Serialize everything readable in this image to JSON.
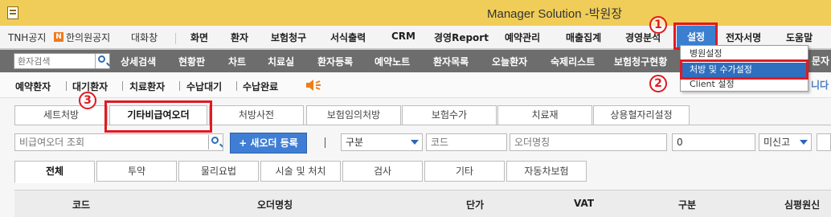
{
  "window": {
    "title": "Manager Solution -박원장"
  },
  "main_menu": {
    "items": [
      {
        "label": "TNH공지"
      },
      {
        "label": "N"
      },
      {
        "label": "한의원공지"
      },
      {
        "label": "대화창"
      },
      {
        "label": "화면"
      },
      {
        "label": "환자"
      },
      {
        "label": "보험청구"
      },
      {
        "label": "서식출력"
      },
      {
        "label": "CRM"
      },
      {
        "label": "경영Report"
      },
      {
        "label": "예약관리"
      },
      {
        "label": "매출집계"
      },
      {
        "label": "경영분석"
      },
      {
        "label": "설정"
      },
      {
        "label": "전자서명"
      },
      {
        "label": "도움말"
      }
    ]
  },
  "annotations": {
    "step1": "1",
    "step2": "2",
    "step3": "3"
  },
  "settings_dropdown": {
    "items": [
      {
        "label": "병원설정"
      },
      {
        "label": "처방 및 수가설정"
      },
      {
        "label": "Client 설정"
      }
    ]
  },
  "sub_menu": {
    "search_placeholder": "환자검색",
    "items": [
      {
        "label": "상세검색"
      },
      {
        "label": "현황판"
      },
      {
        "label": "차트"
      },
      {
        "label": "치료실"
      },
      {
        "label": "환자등록"
      },
      {
        "label": "예약노트"
      },
      {
        "label": "환자목록"
      },
      {
        "label": "오늘환자"
      },
      {
        "label": "숙제리스트"
      },
      {
        "label": "보험청구현황"
      }
    ],
    "right_cut": "문자",
    "right_cut2": "니다"
  },
  "reception_bar": {
    "items": [
      {
        "label": "예약환자"
      },
      {
        "label": "대기환자"
      },
      {
        "label": "치료환자"
      },
      {
        "label": "수납대기"
      },
      {
        "label": "수납완료"
      }
    ]
  },
  "top_tabs": [
    {
      "label": "세트처방"
    },
    {
      "label": "기타비급여오더"
    },
    {
      "label": "처방사전"
    },
    {
      "label": "보험임의처방"
    },
    {
      "label": "보험수가"
    },
    {
      "label": "치료재"
    },
    {
      "label": "상용혈자리설정"
    }
  ],
  "filters": {
    "order_search_placeholder": "비급여오더 조회",
    "new_order_label": "+ 새오더 등록",
    "category_label": "구분",
    "code_placeholder": "코드",
    "order_name_placeholder": "오더명칭",
    "amount_value": "0",
    "status_label": "미신고"
  },
  "sub_tabs": [
    {
      "label": "전체"
    },
    {
      "label": "투약"
    },
    {
      "label": "물리요법"
    },
    {
      "label": "시술 및 처치"
    },
    {
      "label": "검사"
    },
    {
      "label": "기타"
    },
    {
      "label": "자동차보험"
    }
  ],
  "table": {
    "columns": [
      "코드",
      "오더명칭",
      "단가",
      "VAT",
      "구분",
      "심평원신"
    ]
  },
  "colors": {
    "titlebar": "#f0cd58",
    "accent_blue": "#3a7fd0",
    "highlight_red": "#e01a22",
    "submenu_bg": "#6d6d6d"
  }
}
